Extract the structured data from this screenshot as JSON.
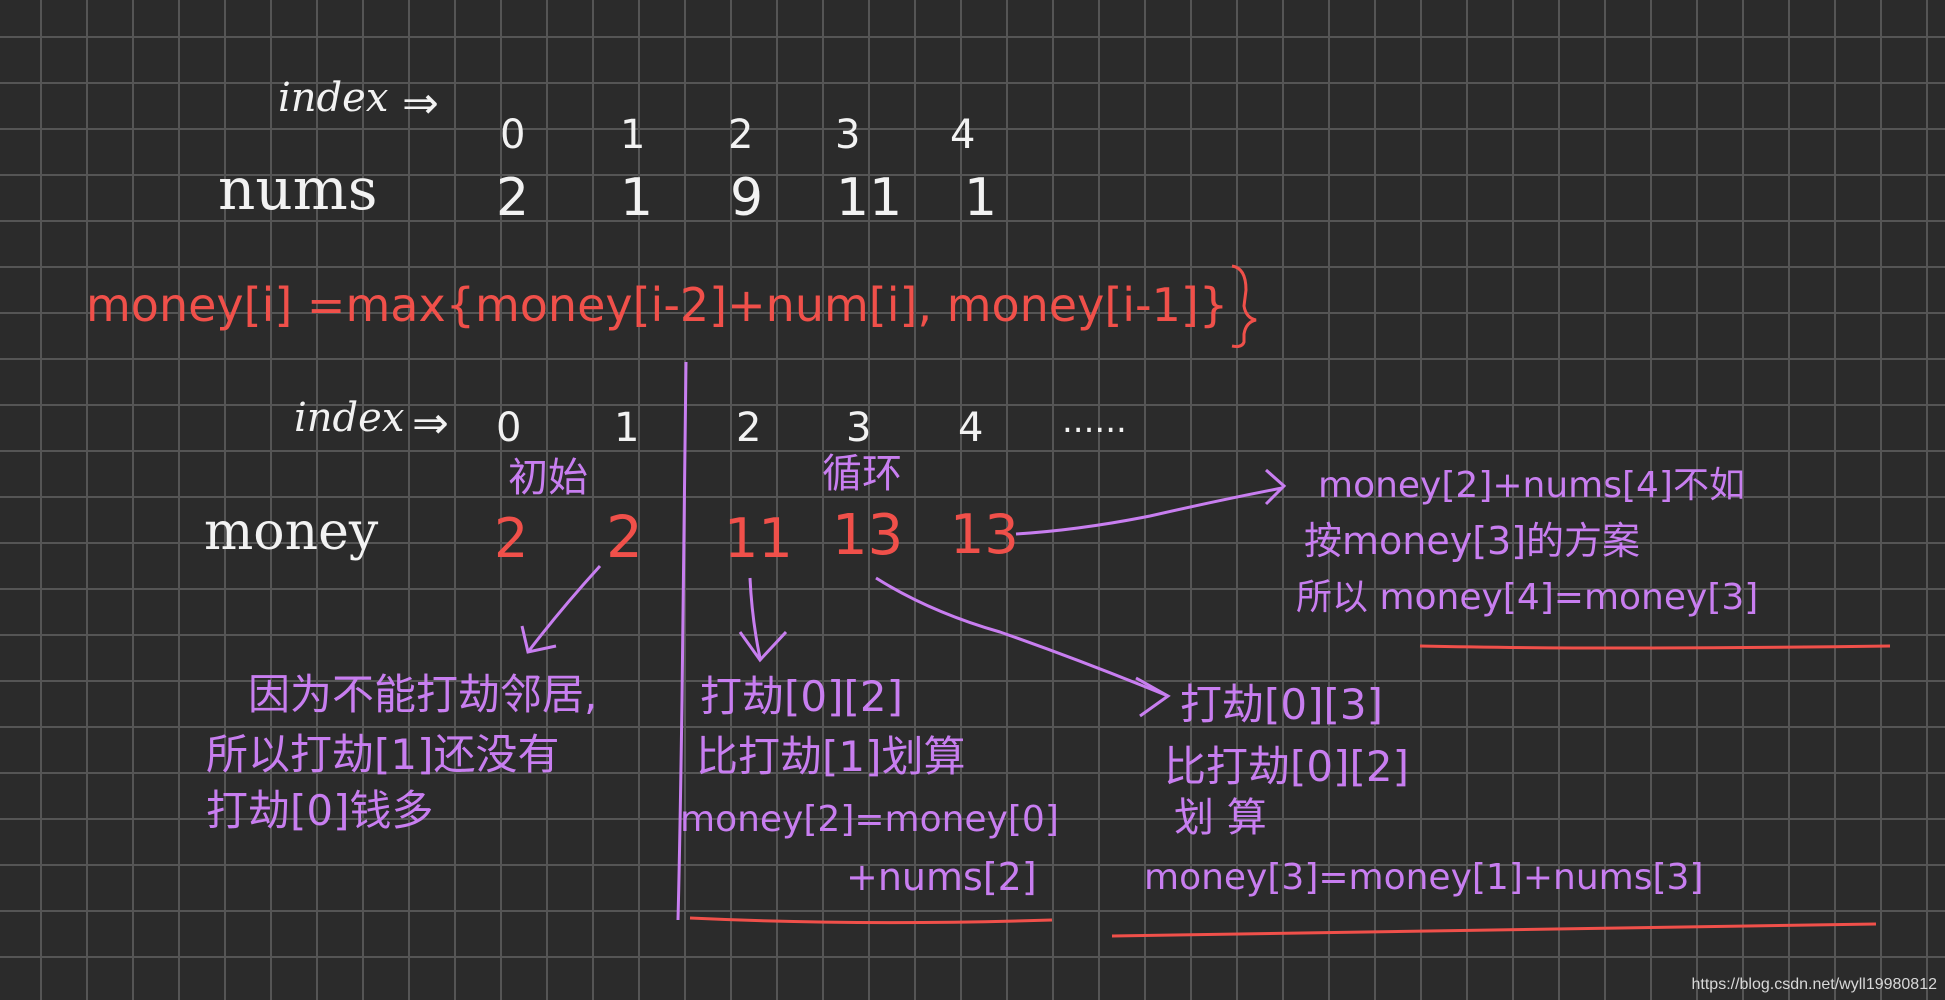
{
  "top_section": {
    "index_label": "index",
    "index_arrow": "⇒",
    "indices": [
      "0",
      "1",
      "2",
      "3",
      "4"
    ],
    "nums_label": "nums",
    "nums_values": [
      "2",
      "1",
      "9",
      "11",
      "1"
    ]
  },
  "formula": "money[i] =max{money[i-2]+num[i], money[i-1]}",
  "bottom_section": {
    "index_label": "index",
    "index_arrow": "⇒",
    "indices": [
      "0",
      "1",
      "2",
      "3",
      "4"
    ],
    "ellipsis": "......",
    "group_init_label": "初始",
    "group_loop_label": "循环",
    "money_label": "money",
    "money_values": [
      "2",
      "2",
      "11",
      "13",
      "13"
    ]
  },
  "notes": {
    "init_note": [
      "因为不能打劫邻居,",
      "所以打劫[1]还没有",
      "打劫[0]钱多"
    ],
    "index2_note": [
      "打劫[0][2]",
      "比打劫[1]划算",
      "money[2]=money[0]",
      "+nums[2]"
    ],
    "index3_note": [
      "打劫[0][3]",
      "比打劫[0][2]",
      "划 算",
      "money[3]=money[1]+nums[3]"
    ],
    "index4_note": [
      "money[2]+nums[4]不如",
      "按money[3]的方案",
      "所以 money[4]=money[3]"
    ]
  },
  "colors": {
    "background": "#2b2b2b",
    "grid": "#555555",
    "chalk_white": "#f2f2f2",
    "chalk_red": "#f0504a",
    "chalk_purple": "#c87ef0"
  },
  "watermark": "https://blog.csdn.net/wyll19980812"
}
